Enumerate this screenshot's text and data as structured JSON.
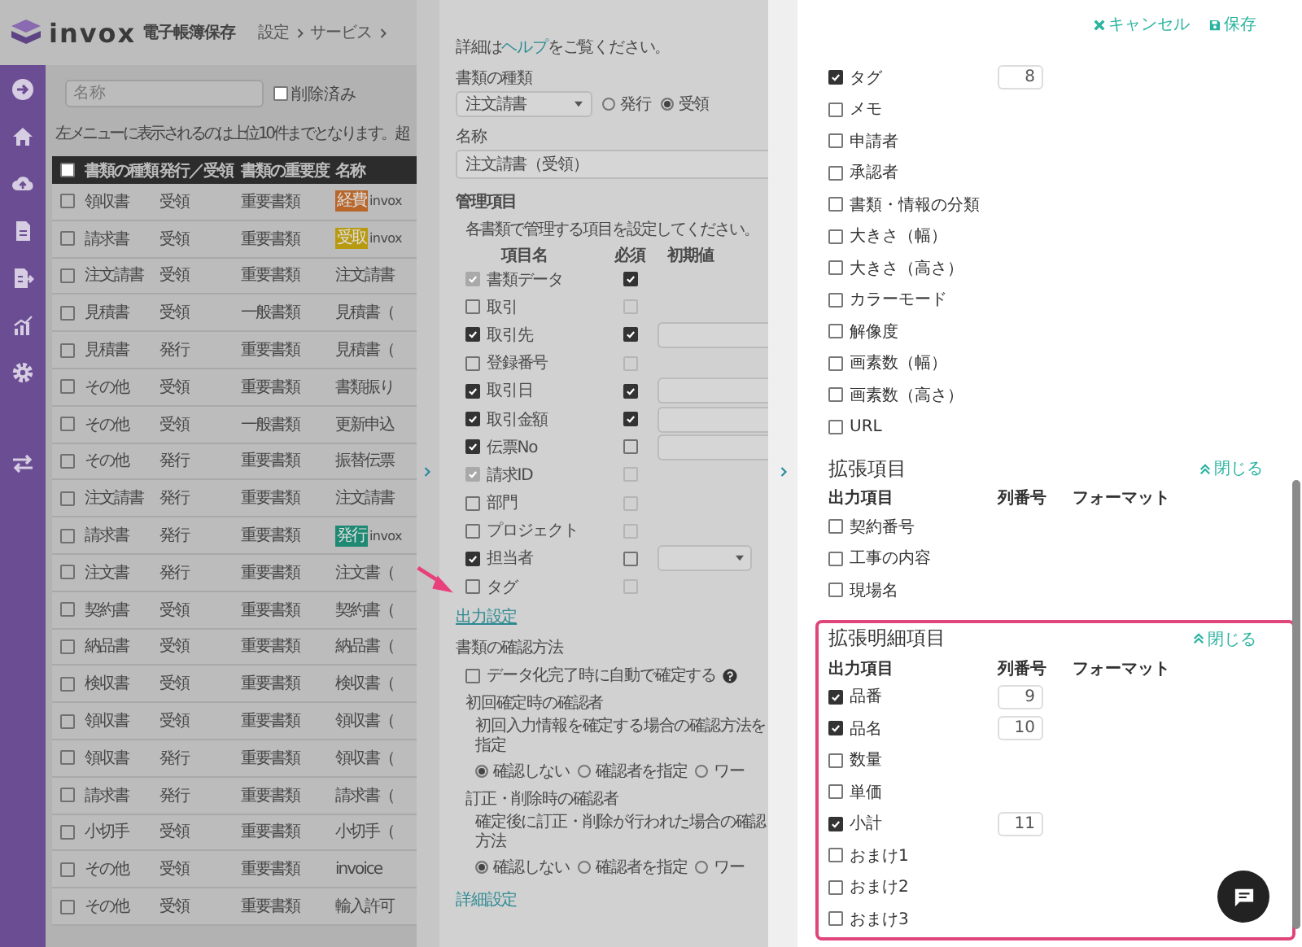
{
  "app": {
    "logo_text": "invox",
    "product": "電子帳簿保存",
    "breadcrumb": [
      "設定",
      "サービス"
    ]
  },
  "list_page": {
    "search": {
      "placeholder": "名称"
    },
    "deleted_filter": {
      "label": "削除済み",
      "checked": false
    },
    "notice": "左メニューに表示されるのは上位10件までとなります。超",
    "table": {
      "select_all_checked": false,
      "columns": [
        "書類の種類",
        "発行／受領",
        "書類の重要度",
        "名称"
      ],
      "rows": [
        {
          "checked": false,
          "type": "領収書",
          "direction": "受領",
          "importance": "重要書類",
          "badge": {
            "label": "経費",
            "color": "#b8662a"
          },
          "name": "invox"
        },
        {
          "checked": false,
          "type": "請求書",
          "direction": "受領",
          "importance": "重要書類",
          "badge": {
            "label": "受取",
            "color": "#b89a10"
          },
          "name": "invox"
        },
        {
          "checked": false,
          "type": "注文請書",
          "direction": "受領",
          "importance": "重要書類",
          "name": "注文請書"
        },
        {
          "checked": false,
          "type": "見積書",
          "direction": "受領",
          "importance": "一般書類",
          "name": "見積書（"
        },
        {
          "checked": false,
          "type": "見積書",
          "direction": "発行",
          "importance": "重要書類",
          "name": "見積書（"
        },
        {
          "checked": false,
          "type": "その他",
          "direction": "受領",
          "importance": "重要書類",
          "name": "書類振り"
        },
        {
          "checked": false,
          "type": "その他",
          "direction": "受領",
          "importance": "一般書類",
          "name": "更新申込"
        },
        {
          "checked": false,
          "type": "その他",
          "direction": "発行",
          "importance": "重要書類",
          "name": "振替伝票"
        },
        {
          "checked": false,
          "type": "注文請書",
          "direction": "発行",
          "importance": "重要書類",
          "name": "注文請書"
        },
        {
          "checked": false,
          "type": "請求書",
          "direction": "発行",
          "importance": "重要書類",
          "badge": {
            "label": "発行",
            "color": "#1f8a74"
          },
          "name": "invox"
        },
        {
          "checked": false,
          "type": "注文書",
          "direction": "発行",
          "importance": "重要書類",
          "name": "注文書（"
        },
        {
          "checked": false,
          "type": "契約書",
          "direction": "受領",
          "importance": "重要書類",
          "name": "契約書（"
        },
        {
          "checked": false,
          "type": "納品書",
          "direction": "受領",
          "importance": "重要書類",
          "name": "納品書（"
        },
        {
          "checked": false,
          "type": "検収書",
          "direction": "受領",
          "importance": "重要書類",
          "name": "検収書（"
        },
        {
          "checked": false,
          "type": "領収書",
          "direction": "受領",
          "importance": "重要書類",
          "name": "領収書（"
        },
        {
          "checked": false,
          "type": "領収書",
          "direction": "発行",
          "importance": "重要書類",
          "name": "領収書（"
        },
        {
          "checked": false,
          "type": "請求書",
          "direction": "発行",
          "importance": "重要書類",
          "name": "請求書（"
        },
        {
          "checked": false,
          "type": "小切手",
          "direction": "受領",
          "importance": "重要書類",
          "name": "小切手（"
        },
        {
          "checked": false,
          "type": "その他",
          "direction": "受領",
          "importance": "重要書類",
          "name": "invoice"
        },
        {
          "checked": false,
          "type": "その他",
          "direction": "受領",
          "importance": "重要書類",
          "name": "輸入許可"
        }
      ]
    }
  },
  "settings_form": {
    "help_prefix": "詳細は",
    "help_link": "ヘルプ",
    "help_suffix": "をご覧ください。",
    "doc_type": {
      "label": "書類の種類",
      "value": "注文請書"
    },
    "direction_options": [
      {
        "label": "発行",
        "selected": false
      },
      {
        "label": "受領",
        "selected": true
      }
    ],
    "name_field": {
      "label": "名称",
      "value": "注文請書（受領）"
    },
    "management": {
      "title": "管理項目",
      "description": "各書類で管理する項目を設定してください。",
      "columns": [
        "項目名",
        "必須",
        "初期値"
      ],
      "items": [
        {
          "label": "書類データ",
          "checked": true,
          "disabled": true,
          "required": {
            "checked": true,
            "disabled": false
          },
          "kind": "plain"
        },
        {
          "label": "取引",
          "checked": false,
          "disabled": false,
          "required": {
            "checked": false,
            "disabled": true
          },
          "kind": "plain"
        },
        {
          "label": "取引先",
          "checked": true,
          "disabled": false,
          "required": {
            "checked": true,
            "disabled": false
          },
          "kind": "text"
        },
        {
          "label": "登録番号",
          "checked": false,
          "disabled": false,
          "required": {
            "checked": false,
            "disabled": true
          },
          "kind": "plain"
        },
        {
          "label": "取引日",
          "checked": true,
          "disabled": false,
          "required": {
            "checked": true,
            "disabled": false
          },
          "kind": "text"
        },
        {
          "label": "取引金額",
          "checked": true,
          "disabled": false,
          "required": {
            "checked": true,
            "disabled": false
          },
          "kind": "text"
        },
        {
          "label": "伝票No",
          "checked": true,
          "disabled": false,
          "required": {
            "checked": false,
            "disabled": false
          },
          "kind": "text"
        },
        {
          "label": "請求ID",
          "checked": true,
          "disabled": true,
          "required": {
            "checked": false,
            "disabled": true
          },
          "kind": "plain"
        },
        {
          "label": "部門",
          "checked": false,
          "disabled": false,
          "required": {
            "checked": false,
            "disabled": true
          },
          "kind": "plain"
        },
        {
          "label": "プロジェクト",
          "checked": false,
          "disabled": false,
          "required": {
            "checked": false,
            "disabled": true
          },
          "kind": "plain"
        },
        {
          "label": "担当者",
          "checked": true,
          "disabled": false,
          "required": {
            "checked": false,
            "disabled": false
          },
          "kind": "select"
        },
        {
          "label": "タグ",
          "checked": false,
          "disabled": false,
          "required": {
            "checked": false,
            "disabled": true
          },
          "kind": "plain"
        }
      ]
    },
    "output_settings_link": "出力設定",
    "confirmation": {
      "title": "書類の確認方法",
      "auto_confirm": {
        "label": "データ化完了時に自動で確定する",
        "checked": false
      },
      "groups": [
        {
          "title": "初回確定時の確認者",
          "description": "初回入力情報を確定する場合の確認方法を指定",
          "options": [
            {
              "label": "確認しない",
              "selected": true
            },
            {
              "label": "確認者を指定",
              "selected": false
            },
            {
              "label": "ワー",
              "selected": false
            }
          ]
        },
        {
          "title": "訂正・削除時の確認者",
          "description": "確定後に訂正・削除が行われた場合の確認方法",
          "options": [
            {
              "label": "確認しない",
              "selected": true
            },
            {
              "label": "確認者を指定",
              "selected": false
            },
            {
              "label": "ワー",
              "selected": false
            }
          ]
        }
      ]
    },
    "advanced_link": "詳細設定"
  },
  "output_panel": {
    "actions": [
      {
        "kind": "cancel",
        "label": "キャンセル"
      },
      {
        "kind": "save",
        "label": "保存"
      }
    ],
    "items": [
      {
        "label": "タグ",
        "checked": true,
        "column": "8"
      },
      {
        "label": "メモ",
        "checked": false
      },
      {
        "label": "申請者",
        "checked": false
      },
      {
        "label": "承認者",
        "checked": false
      },
      {
        "label": "書類・情報の分類",
        "checked": false
      },
      {
        "label": "大きさ（幅）",
        "checked": false
      },
      {
        "label": "大きさ（高さ）",
        "checked": false
      },
      {
        "label": "カラーモード",
        "checked": false
      },
      {
        "label": "解像度",
        "checked": false
      },
      {
        "label": "画素数（幅）",
        "checked": false
      },
      {
        "label": "画素数（高さ）",
        "checked": false
      },
      {
        "label": "URL",
        "checked": false
      }
    ],
    "sections": [
      {
        "title": "拡張項目",
        "toggle": "閉じる",
        "highlighted": false,
        "columns": [
          "出力項目",
          "列番号",
          "フォーマット"
        ],
        "items": [
          {
            "label": "契約番号",
            "checked": false
          },
          {
            "label": "工事の内容",
            "checked": false
          },
          {
            "label": "現場名",
            "checked": false
          }
        ]
      },
      {
        "title": "拡張明細項目",
        "toggle": "閉じる",
        "highlighted": true,
        "columns": [
          "出力項目",
          "列番号",
          "フォーマット"
        ],
        "items": [
          {
            "label": "品番",
            "checked": true,
            "column": "9"
          },
          {
            "label": "品名",
            "checked": true,
            "column": "10"
          },
          {
            "label": "数量",
            "checked": false
          },
          {
            "label": "単価",
            "checked": false
          },
          {
            "label": "小計",
            "checked": true,
            "column": "11"
          },
          {
            "label": "おまけ1",
            "checked": false
          },
          {
            "label": "おまけ2",
            "checked": false
          },
          {
            "label": "おまけ3",
            "checked": false
          }
        ]
      }
    ]
  }
}
